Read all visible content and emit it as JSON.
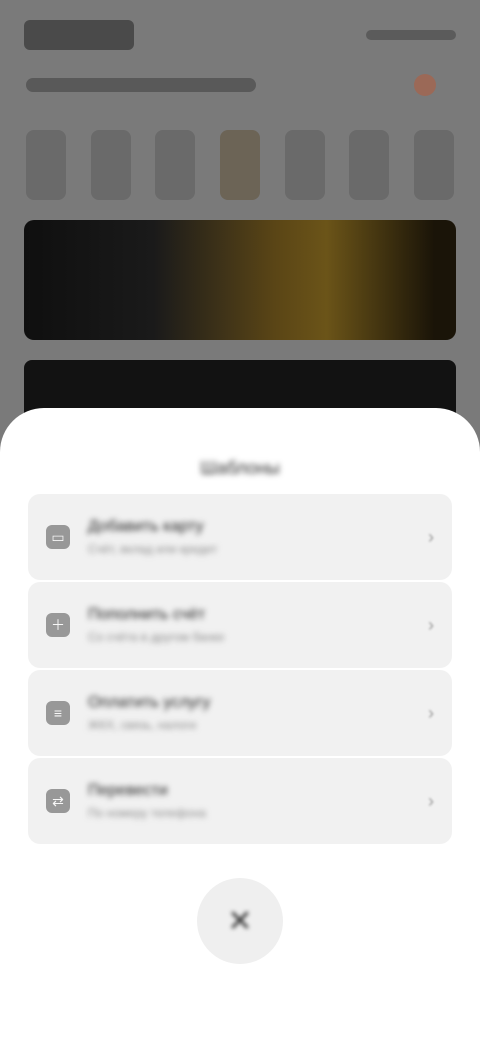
{
  "sheet": {
    "title": "Шаблоны",
    "items": [
      {
        "label": "Добавить карту",
        "desc": "Счёт, вклад или кредит",
        "icon": "card-icon"
      },
      {
        "label": "Пополнить счёт",
        "desc": "Со счёта в другом банке",
        "icon": "topup-icon"
      },
      {
        "label": "Оплатить услугу",
        "desc": "ЖКХ, связь, налоги",
        "icon": "receipt-icon"
      },
      {
        "label": "Перевести",
        "desc": "По номеру телефона",
        "icon": "transfer-icon"
      }
    ],
    "close_icon": "close-icon"
  }
}
